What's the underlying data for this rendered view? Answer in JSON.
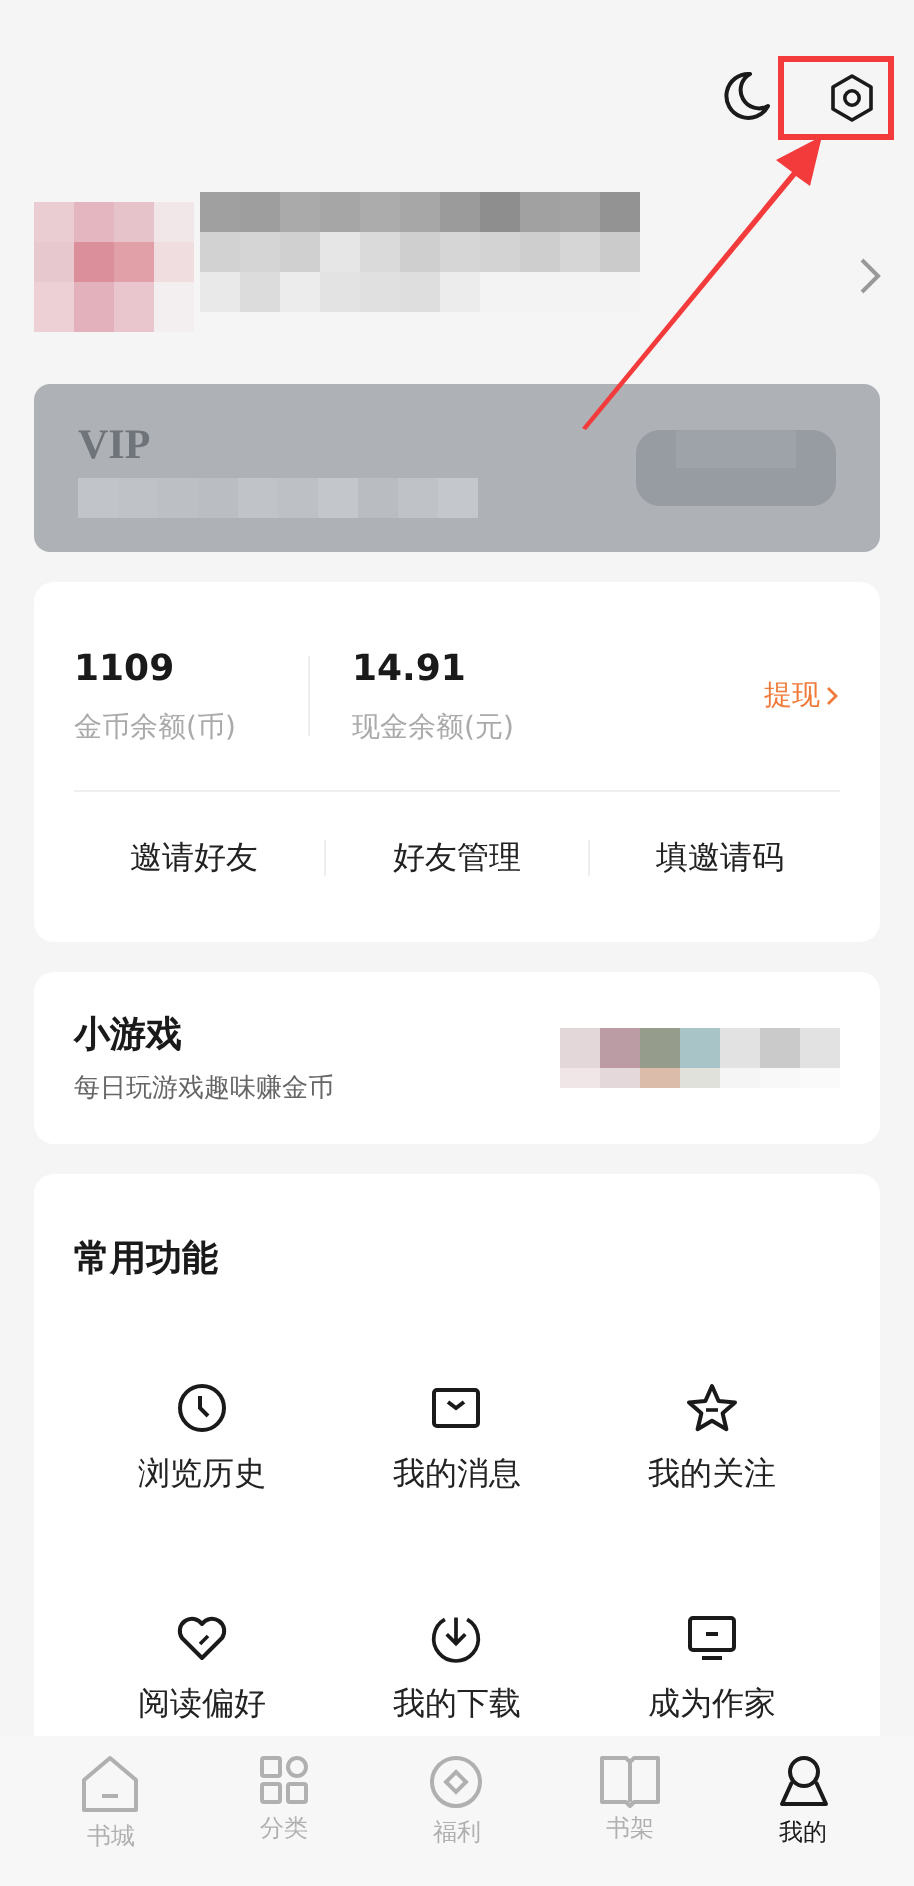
{
  "vip_card": {
    "title": "VIP"
  },
  "balances": [
    {
      "value": "1109",
      "label": "金币余额(币)"
    },
    {
      "value": "14.91",
      "label": "现金余额(元)"
    }
  ],
  "withdraw": {
    "label": "提现"
  },
  "friend_actions": [
    "邀请好友",
    "好友管理",
    "填邀请码"
  ],
  "mini_games": {
    "title": "小游戏",
    "subtitle": "每日玩游戏趣味赚金币"
  },
  "functions": {
    "title": "常用功能",
    "items": [
      "浏览历史",
      "我的消息",
      "我的关注",
      "阅读偏好",
      "我的下载",
      "成为作家"
    ]
  },
  "tabs": [
    {
      "label": "书城",
      "selected": false
    },
    {
      "label": "分类",
      "selected": false
    },
    {
      "label": "福利",
      "selected": false
    },
    {
      "label": "书架",
      "selected": false
    },
    {
      "label": "我的",
      "selected": true
    }
  ]
}
